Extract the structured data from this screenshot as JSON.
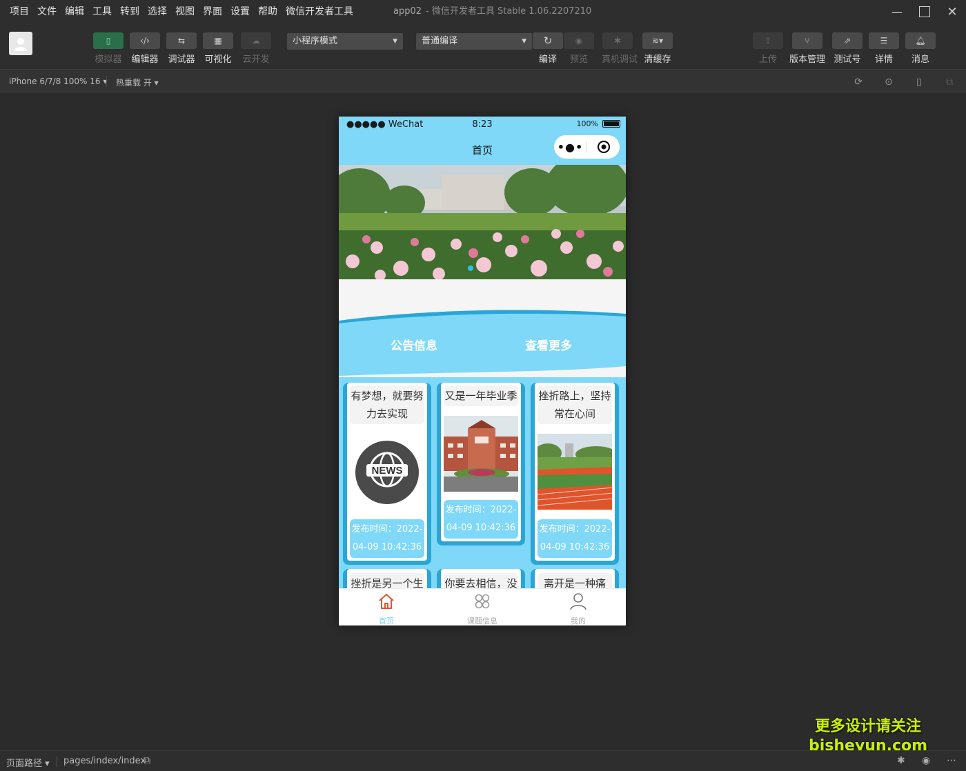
{
  "menubar": {
    "items": [
      "项目",
      "文件",
      "编辑",
      "工具",
      "转到",
      "选择",
      "视图",
      "界面",
      "设置",
      "帮助",
      "微信开发者工具"
    ],
    "app_name": "app02",
    "title": "- 微信开发者工具 Stable 1.06.2207210"
  },
  "toolbar": {
    "simulator": "模拟器",
    "editor": "编辑器",
    "debugger": "调试器",
    "visual": "可视化",
    "cloud": "云开发",
    "mode_select": "小程序模式",
    "compile_select": "普通编译",
    "compile": "编译",
    "preview": "预览",
    "remote_debug": "真机调试",
    "clear_cache": "清缓存",
    "upload": "上传",
    "version": "版本管理",
    "test_account": "测试号",
    "details": "详情",
    "messages": "消息"
  },
  "subbar": {
    "device": "iPhone 6/7/8 100% 16 ▾",
    "hot_reload": "热重载 开 ▾"
  },
  "phone": {
    "carrier": "●●●●● WeChat",
    "time": "8:23",
    "battery": "100%",
    "nav_title": "首页",
    "notice_label": "公告信息",
    "more_label": "查看更多",
    "cards": [
      {
        "title": "有梦想，就要努力去实现",
        "time": "发布时间：2022-04-09 10:42:36",
        "image": "news-globe"
      },
      {
        "title": "又是一年毕业季",
        "time": "发布时间：2022-04-09 10:42:36",
        "image": "campus-building"
      },
      {
        "title": "挫折路上，坚持常在心间",
        "time": "发布时间：2022-04-09 10:42:36",
        "image": "running-track"
      }
    ],
    "cards_row2": [
      "挫折是另一个生",
      "你要去相信，没",
      "离开是一种痛"
    ],
    "tabs": [
      {
        "label": "首页",
        "icon": "home-icon",
        "active": true
      },
      {
        "label": "课题信息",
        "icon": "grid-icon",
        "active": false
      },
      {
        "label": "我的",
        "icon": "user-icon",
        "active": false
      }
    ],
    "accent_color": "#7fd8f7"
  },
  "bottombar": {
    "path_label": "页面路径 ▾",
    "path": "pages/index/index"
  },
  "watermark": {
    "line1": "更多设计请关注",
    "line2": "bisheyun.com"
  }
}
